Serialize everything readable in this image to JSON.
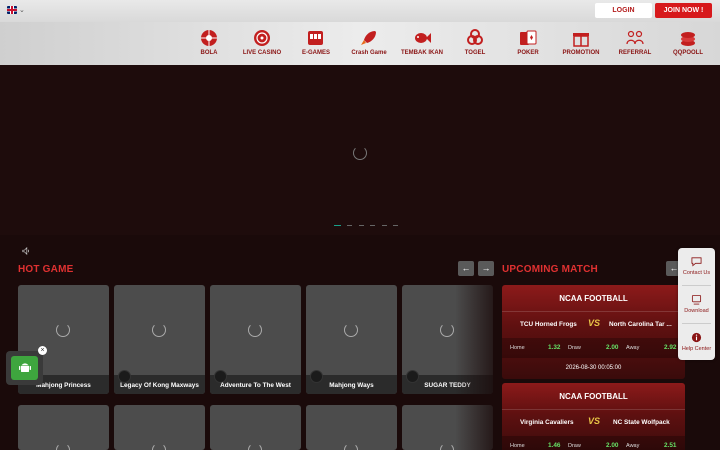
{
  "header": {
    "login_label": "LOGIN",
    "join_label": "JOIN NOW !",
    "nav_items": [
      {
        "label": "BOLA",
        "icon": "ball-icon"
      },
      {
        "label": "LIVE CASINO",
        "icon": "roulette-icon"
      },
      {
        "label": "E-GAMES",
        "icon": "slot-machine-icon"
      },
      {
        "label": "Crash Game",
        "icon": "rocket-icon"
      },
      {
        "label": "TEMBAK IKAN",
        "icon": "fish-icon"
      },
      {
        "label": "TOGEL",
        "icon": "lottery-balls-icon"
      },
      {
        "label": "POKER",
        "icon": "cards-icon"
      },
      {
        "label": "PROMOTION",
        "icon": "gift-icon"
      },
      {
        "label": "REFERRAL",
        "icon": "people-icon"
      },
      {
        "label": "QQPOOLL",
        "icon": "chips-icon"
      }
    ]
  },
  "hot_game": {
    "title": "HOT GAME",
    "games": [
      {
        "name": "Mahjong Princess"
      },
      {
        "name": "Legacy Of Kong Maxways"
      },
      {
        "name": "Adventure To The West"
      },
      {
        "name": "Mahjong Ways"
      },
      {
        "name": "SUGAR TEDDY"
      }
    ]
  },
  "upcoming_match": {
    "title": "UPCOMING MATCH",
    "matches": [
      {
        "league": "NCAA FOOTBALL",
        "home_team": "TCU Horned Frogs",
        "away_team": "North Carolina Tar ...",
        "vs": "VS",
        "home_label": "Home",
        "home_odds": "1.32",
        "draw_label": "Draw",
        "draw_odds": "2.00",
        "away_label": "Away",
        "away_odds": "2.92",
        "time": "2026-08-30 00:05:00"
      },
      {
        "league": "NCAA FOOTBALL",
        "home_team": "Virginia Cavaliers",
        "away_team": "NC State Wolfpack",
        "vs": "VS",
        "home_label": "Home",
        "home_odds": "1.46",
        "draw_label": "Draw",
        "draw_odds": "2.00",
        "away_label": "Away",
        "away_odds": "2.51"
      }
    ]
  },
  "side_widget": {
    "contact_label": "Contact Us",
    "download_label": "Download",
    "help_label": "Help Center"
  },
  "colors": {
    "accent_red": "#d7191c",
    "title_red": "#e03131",
    "odds_green": "#66e266"
  }
}
